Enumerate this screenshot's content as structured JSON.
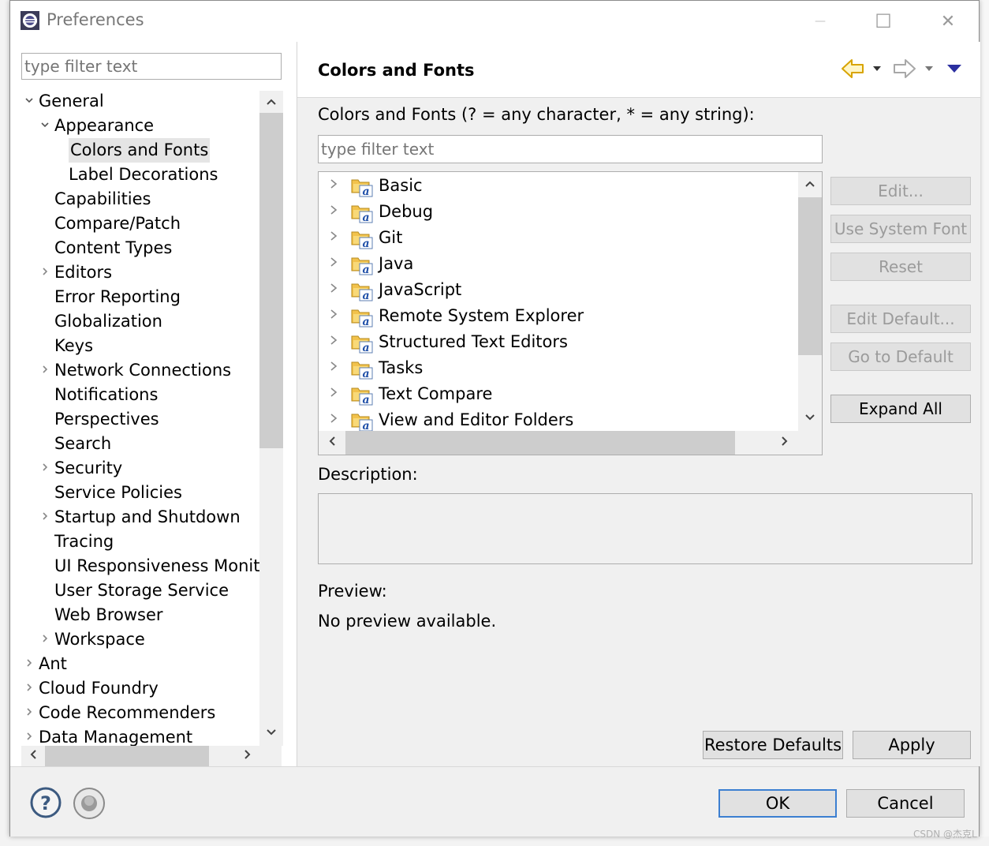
{
  "window": {
    "title": "Preferences",
    "minimize_symbol": "—",
    "maximize_symbol": "☐",
    "close_symbol": "✕"
  },
  "left_panel": {
    "filter_placeholder": "type filter text",
    "tree": [
      {
        "label": "General",
        "level": 0,
        "arrow": "expanded"
      },
      {
        "label": "Appearance",
        "level": 1,
        "arrow": "expanded"
      },
      {
        "label": "Colors and Fonts",
        "level": 2,
        "arrow": "none",
        "selected": true
      },
      {
        "label": "Label Decorations",
        "level": 2,
        "arrow": "none"
      },
      {
        "label": "Capabilities",
        "level": 1,
        "arrow": "none"
      },
      {
        "label": "Compare/Patch",
        "level": 1,
        "arrow": "none"
      },
      {
        "label": "Content Types",
        "level": 1,
        "arrow": "none"
      },
      {
        "label": "Editors",
        "level": 1,
        "arrow": "collapsed"
      },
      {
        "label": "Error Reporting",
        "level": 1,
        "arrow": "none"
      },
      {
        "label": "Globalization",
        "level": 1,
        "arrow": "none"
      },
      {
        "label": "Keys",
        "level": 1,
        "arrow": "none"
      },
      {
        "label": "Network Connections",
        "level": 1,
        "arrow": "collapsed"
      },
      {
        "label": "Notifications",
        "level": 1,
        "arrow": "none"
      },
      {
        "label": "Perspectives",
        "level": 1,
        "arrow": "none"
      },
      {
        "label": "Search",
        "level": 1,
        "arrow": "none"
      },
      {
        "label": "Security",
        "level": 1,
        "arrow": "collapsed"
      },
      {
        "label": "Service Policies",
        "level": 1,
        "arrow": "none"
      },
      {
        "label": "Startup and Shutdown",
        "level": 1,
        "arrow": "collapsed"
      },
      {
        "label": "Tracing",
        "level": 1,
        "arrow": "none"
      },
      {
        "label": "UI Responsiveness Monitoring",
        "level": 1,
        "arrow": "none"
      },
      {
        "label": "User Storage Service",
        "level": 1,
        "arrow": "none"
      },
      {
        "label": "Web Browser",
        "level": 1,
        "arrow": "none"
      },
      {
        "label": "Workspace",
        "level": 1,
        "arrow": "collapsed"
      },
      {
        "label": "Ant",
        "level": 0,
        "arrow": "collapsed"
      },
      {
        "label": "Cloud Foundry",
        "level": 0,
        "arrow": "collapsed"
      },
      {
        "label": "Code Recommenders",
        "level": 0,
        "arrow": "collapsed"
      },
      {
        "label": "Data Management",
        "level": 0,
        "arrow": "collapsed"
      }
    ]
  },
  "page": {
    "title": "Colors and Fonts",
    "filter_label": "Colors and Fonts (? = any character, * = any string):",
    "filter_placeholder": "type filter text",
    "categories": [
      "Basic",
      "Debug",
      "Git",
      "Java",
      "JavaScript",
      "Remote System Explorer",
      "Structured Text Editors",
      "Tasks",
      "Text Compare",
      "View and Editor Folders"
    ],
    "buttons": {
      "edit": "Edit...",
      "use_system_font": "Use System Font",
      "reset": "Reset",
      "edit_default": "Edit Default...",
      "go_to_default": "Go to Default",
      "expand_all": "Expand All",
      "restore_defaults": "Restore Defaults",
      "apply": "Apply"
    },
    "description_label": "Description:",
    "preview_label": "Preview:",
    "preview_text": "No preview available."
  },
  "footer": {
    "ok": "OK",
    "cancel": "Cancel",
    "help_icon": "question-circle-icon",
    "import_export_icon": "gray-disc-icon"
  },
  "watermark": "CSDN @杰克L",
  "colors": {
    "dialog_bg": "#f0f0f0",
    "selection_bg": "#e5e5e5",
    "disabled_text": "#9b9b9b",
    "default_button_border": "#3c7fd1",
    "back_arrow": "#f2c200",
    "menu_triangle": "#2b2fa0"
  }
}
